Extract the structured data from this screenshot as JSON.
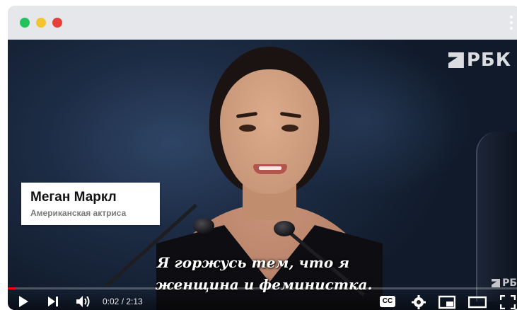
{
  "window": {
    "controls": [
      "close",
      "minimize",
      "maximize"
    ],
    "menu_icon": "more-vertical-icon"
  },
  "video": {
    "brand_logo": "РБК",
    "brand_logo_small": "РБ",
    "lower_third": {
      "name": "Меган Маркл",
      "role": "Американская актриса"
    },
    "subtitles": {
      "line1": "Я горжусь тем, что я",
      "line2": "женщина и феминистка."
    }
  },
  "player": {
    "current_time": "0:02",
    "duration": "2:13",
    "time_display": "0:02 / 2:13",
    "progress_fraction": 0.015,
    "accent_color": "#ff0000",
    "buttons": [
      "play-icon",
      "next-icon",
      "volume-icon",
      "captions-icon",
      "settings-icon",
      "miniplayer-icon",
      "theater-icon",
      "fullscreen-icon"
    ],
    "captions_label": "CC"
  }
}
